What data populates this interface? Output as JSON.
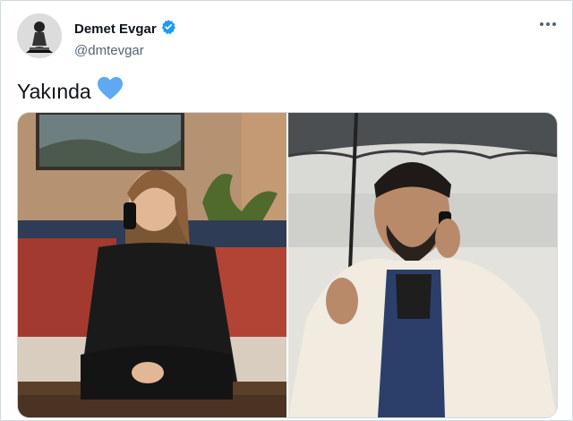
{
  "tweet": {
    "display_name": "Demet Evgar",
    "handle": "@dmtevgar",
    "verified": true,
    "text": "Yakında",
    "emoji": "blue-heart-icon",
    "more_icon": "more-horizontal-icon"
  },
  "colors": {
    "verified": "#1d9bf0",
    "heart": "#5ea9f2",
    "handle": "#536471"
  },
  "media": {
    "count": 2,
    "items": [
      "woman-on-phone-photo",
      "man-with-umbrella-on-phone-photo"
    ]
  }
}
